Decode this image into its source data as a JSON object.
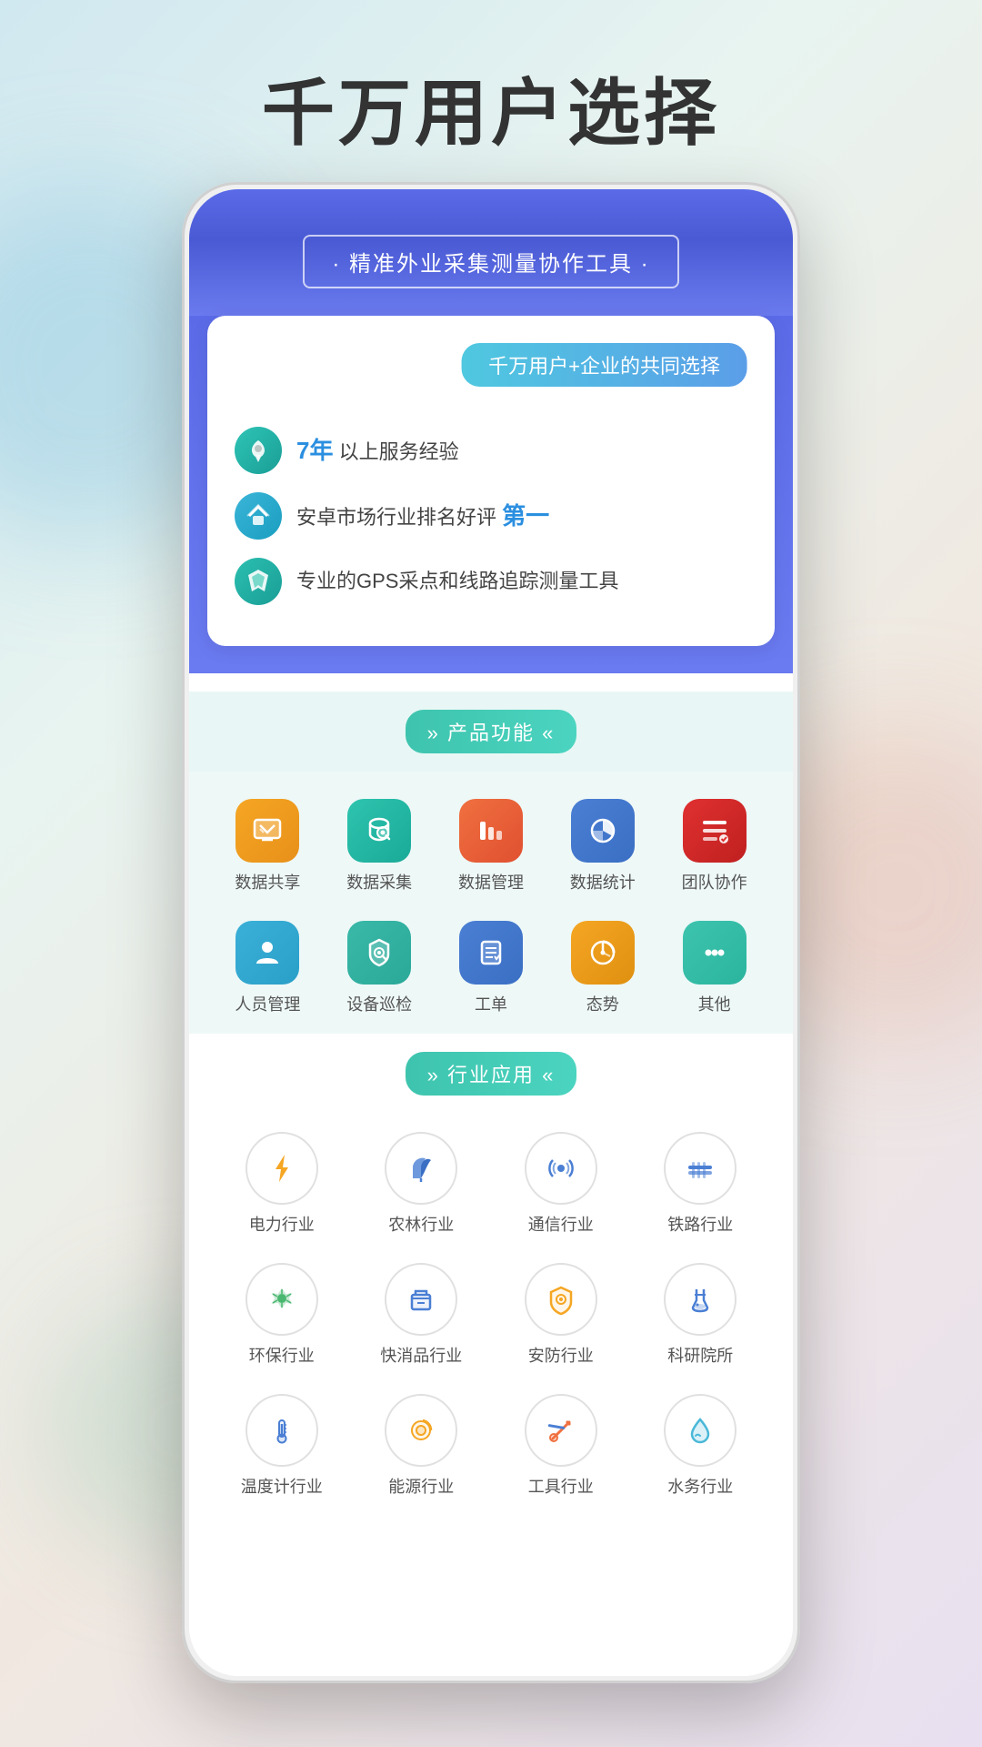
{
  "page": {
    "title": "千万用户选择",
    "background_colors": [
      "#d0e8f0",
      "#e8f4f0",
      "#f0e8e0"
    ]
  },
  "header": {
    "subtitle": "· 精准外业采集测量协作工具 ·",
    "banner_text": "千万用户+企业的共同选择"
  },
  "features": [
    {
      "icon_type": "heart-star",
      "text_prefix": "",
      "bold": "7年",
      "text_suffix": " 以上服务经验",
      "icon_color": "teal"
    },
    {
      "icon_type": "crown",
      "text_prefix": "安卓市场行业排名好评 ",
      "bold": "第一",
      "text_suffix": "",
      "icon_color": "blue"
    },
    {
      "icon_type": "location",
      "text_prefix": "专业的GPS采点和线路追踪测量工具",
      "bold": "",
      "text_suffix": "",
      "icon_color": "teal2"
    }
  ],
  "product_section": {
    "header": "»  产品功能  «",
    "items": [
      {
        "label": "数据共享",
        "color": "#f5a623",
        "icon": "share"
      },
      {
        "label": "数据采集",
        "color": "#2ec4ae",
        "icon": "database"
      },
      {
        "label": "数据管理",
        "color": "#f07040",
        "icon": "chart-bar"
      },
      {
        "label": "数据统计",
        "color": "#4a7fd4",
        "icon": "pie"
      },
      {
        "label": "团队协作",
        "color": "#e03030",
        "icon": "team"
      },
      {
        "label": "人员管理",
        "color": "#3ab0d8",
        "icon": "person"
      },
      {
        "label": "设备巡检",
        "color": "#3ab8a8",
        "icon": "shield-search"
      },
      {
        "label": "工单",
        "color": "#4a7fd4",
        "icon": "clipboard"
      },
      {
        "label": "态势",
        "color": "#f5a623",
        "icon": "donut"
      },
      {
        "label": "其他",
        "color": "#3ec4ae",
        "icon": "dots"
      }
    ]
  },
  "industry_section": {
    "header": "»  行业应用  «",
    "items": [
      {
        "label": "电力行业",
        "icon": "lightning",
        "color": "#f5a623"
      },
      {
        "label": "农林行业",
        "icon": "tree",
        "color": "#4a7fd4"
      },
      {
        "label": "通信行业",
        "icon": "signal",
        "color": "#4a7fd4"
      },
      {
        "label": "铁路行业",
        "icon": "rail",
        "color": "#4a7fd4"
      },
      {
        "label": "环保行业",
        "icon": "leaf",
        "color": "#4ab870"
      },
      {
        "label": "快消品行业",
        "icon": "box",
        "color": "#4a7fd4"
      },
      {
        "label": "安防行业",
        "icon": "shield",
        "color": "#f5a623"
      },
      {
        "label": "科研院所",
        "icon": "flask",
        "color": "#4a7fd4"
      },
      {
        "label": "温度计行业",
        "icon": "thermometer",
        "color": "#4a7fd4"
      },
      {
        "label": "能源行业",
        "icon": "bulb",
        "color": "#f5a623"
      },
      {
        "label": "工具行业",
        "icon": "wrench",
        "color": "#f07040"
      },
      {
        "label": "水务行业",
        "icon": "drop",
        "color": "#4ab8d8"
      }
    ]
  }
}
